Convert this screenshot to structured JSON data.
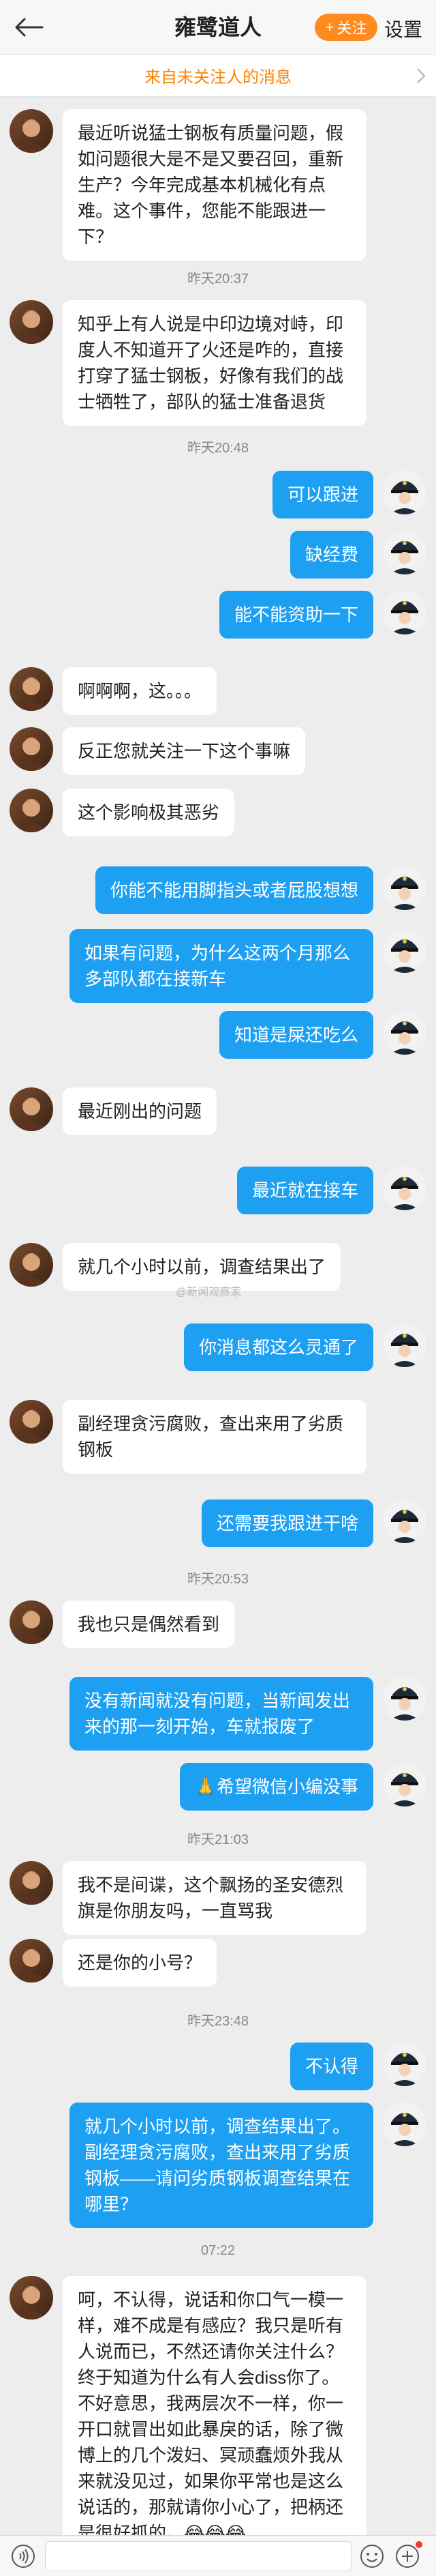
{
  "header": {
    "title": "雍鹭道人",
    "follow_label": "关注",
    "settings_label": "设置"
  },
  "banner": {
    "text": "来自未关注人的消息"
  },
  "watermark": "@新闻观察家",
  "timestamps": {
    "t1": "昨天20:37",
    "t2": "昨天20:48",
    "t3": "昨天20:53",
    "t4": "昨天21:03",
    "t5": "昨天23:48",
    "t6": "07:22"
  },
  "messages": {
    "m1": "最近听说猛士钢板有质量问题，假如问题很大是不是又要召回，重新生产？今年完成基本机械化有点难。这个事件，您能不能跟进一下？",
    "m2": "知乎上有人说是中印边境对峙，印度人不知道开了火还是咋的，直接打穿了猛士钢板，好像有我们的战士牺牲了，部队的猛士准备退货",
    "m3": "可以跟进",
    "m4": "缺经费",
    "m5": "能不能资助一下",
    "m6": "啊啊啊，这。。。",
    "m7": "反正您就关注一下这个事嘛",
    "m8": "这个影响极其恶劣",
    "m9": "你能不能用脚指头或者屁股想想",
    "m10": "如果有问题，为什么这两个月那么多部队都在接新车",
    "m11": "知道是屎还吃么",
    "m12": "最近刚出的问题",
    "m13": "最近就在接车",
    "m14": "就几个小时以前，调查结果出了",
    "m15": "你消息都这么灵通了",
    "m16": "副经理贪污腐败，查出来用了劣质钢板",
    "m17": "还需要我跟进干啥",
    "m18": "我也只是偶然看到",
    "m19": "没有新闻就没有问题，当新闻发出来的那一刻开始，车就报废了",
    "m20": "🙏希望微信小编没事",
    "m21": "我不是间谍，这个飘扬的圣安德烈旗是你朋友吗，一直骂我",
    "m22": "还是你的小号？",
    "m23": "不认得",
    "m24": "就几个小时以前，调查结果出了。副经理贪污腐败，查出来用了劣质钢板——请问劣质钢板调查结果在哪里？",
    "m25": "呵，不认得，说话和你口气一模一样，难不成是有感应？我只是听有人说而已，不然还请你关注什么？终于知道为什么有人会diss你了。不好意思，我两层次不一样，你一开口就冒出如此暴戾的话，除了微博上的几个泼妇、冥顽蠢烦外我从来就没见过，如果你平常也是这么说话的，那就请你小心了，把柄还是很好抓的。😂😂😂"
  },
  "colors": {
    "accent": "#ff8a1f",
    "bubble_right": "#1ea0f2",
    "bubble_left": "#ffffff",
    "banner_text": "#ff8200",
    "background": "#ededed"
  },
  "icons": {
    "back": "back-arrow-icon",
    "plus": "plus-icon",
    "chevron": "chevron-right-icon",
    "voice": "voice-icon",
    "emoji": "emoji-icon",
    "add": "add-icon"
  }
}
